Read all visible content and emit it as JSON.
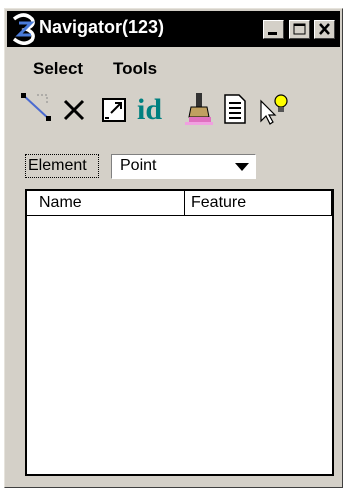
{
  "window": {
    "title": "Navigator(123)"
  },
  "menubar": {
    "items": [
      {
        "label": "Select"
      },
      {
        "label": "Tools"
      }
    ]
  },
  "toolbar": {
    "tools": [
      {
        "icon": "select-line-icon"
      },
      {
        "icon": "delete-x-icon"
      },
      {
        "icon": "fit-view-icon"
      },
      {
        "icon": "id-icon",
        "label": "id"
      },
      {
        "icon": "highlight-brush-icon"
      },
      {
        "icon": "report-document-icon"
      },
      {
        "icon": "pointer-lightbulb-icon"
      }
    ]
  },
  "filter": {
    "label": "Element",
    "selected": "Point"
  },
  "list": {
    "columns": [
      "Name",
      "Feature"
    ],
    "rows": []
  },
  "colors": {
    "face": "#d4d0c8",
    "titlebar": "#000000",
    "id_teal": "#008080"
  }
}
